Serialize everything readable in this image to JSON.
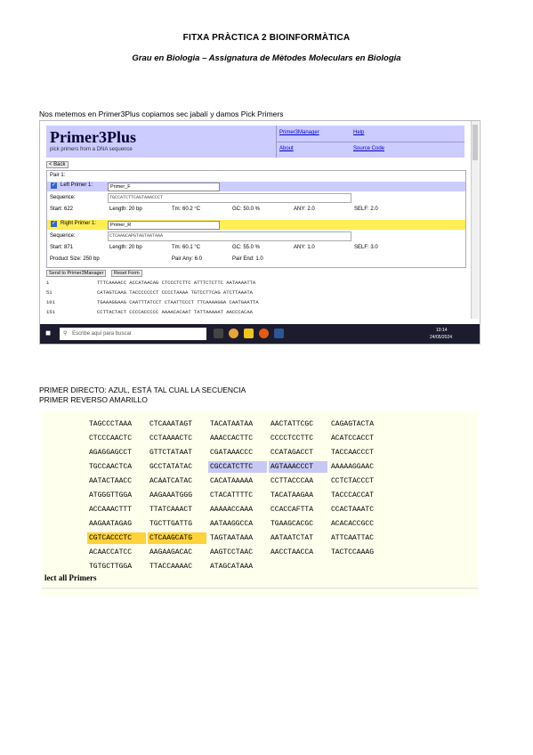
{
  "doc": {
    "title": "FITXA PRÀCTICA 2 BIOINFORMÀTICA",
    "subtitle": "Grau en Biologia – Assignatura de Mètodes Moleculars en Biologia",
    "intro": "Nos metemos en Primer3Plus copiamos sec jabalí y damos Pick Primers",
    "note_forward": "PRIMER DIRECTO: AZUL, ESTÁ TAL CUAL LA SECUENCIA",
    "note_reverse": "PRIMER REVERSO AMARILLO"
  },
  "primer3": {
    "logo": "Primer3Plus",
    "tagline": "pick primers from a DNA sequence",
    "links": [
      "Primer3Manager",
      "Help",
      "About",
      "Source Code"
    ],
    "back": "< Back",
    "pair": "Pair 1:",
    "left_label": "Left Primer 1:",
    "left_name": "Primer_F",
    "right_label": "Right Primer 1:",
    "right_name": "Primer_R",
    "sequence_label": "Sequence:",
    "left_seq": "TGCCATCTTCAGTAAACCCT",
    "right_seq": "CTCAAGCAPGTAGTAATAAA",
    "left_stats": {
      "start": "Start: 622",
      "length": "Length: 20 bp",
      "tm": "Tm: 60.2 °C",
      "gc": "GC: 50.0 %",
      "any": "ANY: 2.0",
      "self": "SELF: 2.0"
    },
    "right_stats": {
      "start": "Start: 871",
      "length": "Length: 20 bp",
      "tm": "Tm: 60.1 °C",
      "gc": "GC: 55.0 %",
      "any": "ANY: 1.0",
      "self": "SELF: 3.0"
    },
    "product_size": "Product Size: 250 bp",
    "pair_any": "Pair Any: 6.0",
    "pair_end": "Pair End: 1.0",
    "btn_send": "Send to Primer3Manager",
    "btn_reset": "Reset Form",
    "seq_lines": [
      {
        "num": "1",
        "seq": "TTTCAAAACC  ACCATAACAG  CTCCCTCTTC  ATTTCTCTTC  AATAAAATTA"
      },
      {
        "num": "51",
        "seq": "CATAGTCAAG  TACCCCCCCT  CCCCTAAAA  TGTCCTTCAG  ATCTTAAATA"
      },
      {
        "num": "101",
        "seq": "TGAAAGGAAG  CAATTTATCCT  CTAATTCCCT  TTCAAAAGGA  CAATGAATTA"
      },
      {
        "num": "151",
        "seq": "CCTTACTACT  CCCCACCCCC  AAAACACAAT  TATTAAAAAT  AACCCACAA"
      }
    ],
    "taskbar_search": "Escribe aquí para buscar",
    "clock": "10:14",
    "date": "24/05/2024"
  },
  "seq_view": {
    "rows": [
      [
        {
          "t": "TAGCCCTAAA",
          "h": ""
        },
        {
          "t": "CTCAAATAGT",
          "h": ""
        },
        {
          "t": "TACATAATAA",
          "h": ""
        },
        {
          "t": "AACTATTCGC",
          "h": ""
        },
        {
          "t": "CAGAGTACTA",
          "h": ""
        }
      ],
      [
        {
          "t": "CTCCCAACTC",
          "h": ""
        },
        {
          "t": "CCTAAAACTC",
          "h": ""
        },
        {
          "t": "AAACCACTTC",
          "h": ""
        },
        {
          "t": "CCCCTCCTTC",
          "h": ""
        },
        {
          "t": "ACATCCACCT",
          "h": ""
        }
      ],
      [
        {
          "t": "AGAGGAGCCT",
          "h": ""
        },
        {
          "t": "GTTCTATAAT",
          "h": ""
        },
        {
          "t": "CGATAAACCC",
          "h": ""
        },
        {
          "t": "CCATAGACCT",
          "h": ""
        },
        {
          "t": "TACCAACCCT",
          "h": ""
        }
      ],
      [
        {
          "t": "TGCCAACTCA",
          "h": ""
        },
        {
          "t": "GCCTATATAC",
          "h": ""
        },
        {
          "t": "CGCCATCTTC",
          "h": "blue"
        },
        {
          "t": "AGTAAACCCT",
          "h": "blue"
        },
        {
          "t": "AAAAAGGAAC",
          "h": ""
        }
      ],
      [
        {
          "t": "AATACTAACC",
          "h": ""
        },
        {
          "t": "ACAATCATAC",
          "h": ""
        },
        {
          "t": "CACATAAAAA",
          "h": ""
        },
        {
          "t": "CCTTACCCAA",
          "h": ""
        },
        {
          "t": "CCTCTACCCT",
          "h": ""
        }
      ],
      [
        {
          "t": "ATGGGTTGGA",
          "h": ""
        },
        {
          "t": "AAGAAATGGG",
          "h": ""
        },
        {
          "t": "CTACATTTTC",
          "h": ""
        },
        {
          "t": "TACATAAGAA",
          "h": ""
        },
        {
          "t": "TACCCACCAT",
          "h": ""
        }
      ],
      [
        {
          "t": "ACCAAACTTT",
          "h": ""
        },
        {
          "t": "TTATCAAACT",
          "h": ""
        },
        {
          "t": "AAAAACCAAA",
          "h": ""
        },
        {
          "t": "CCACCAFTTA",
          "h": ""
        },
        {
          "t": "CCACTAAATC",
          "h": ""
        }
      ],
      [
        {
          "t": "AAGAATAGAG",
          "h": ""
        },
        {
          "t": "TGCTTGATTG",
          "h": ""
        },
        {
          "t": "AATAAGGCCA",
          "h": ""
        },
        {
          "t": "TGAAGCACGC",
          "h": ""
        },
        {
          "t": "ACACACCGCC",
          "h": ""
        }
      ],
      [
        {
          "t": "CGTCACCCTC",
          "h": "yel"
        },
        {
          "t": "CTCAAGCATG",
          "h": "yel"
        },
        {
          "t": "TAGTAATAAA",
          "h": ""
        },
        {
          "t": "AATAATCTAT",
          "h": ""
        },
        {
          "t": "ATTCAATTAC",
          "h": ""
        }
      ],
      [
        {
          "t": "ACAACCATCC",
          "h": ""
        },
        {
          "t": "AAGAAGACAC",
          "h": ""
        },
        {
          "t": "AAGTCCTAAC",
          "h": ""
        },
        {
          "t": "AACCTAACCA",
          "h": ""
        },
        {
          "t": "TACTCCAAAG",
          "h": ""
        }
      ],
      [
        {
          "t": "TGTGCTTGGA",
          "h": ""
        },
        {
          "t": "TTACCAAAAC",
          "h": ""
        },
        {
          "t": "ATAGCATAAA",
          "h": ""
        }
      ]
    ],
    "select_all": "lect all Primers"
  }
}
